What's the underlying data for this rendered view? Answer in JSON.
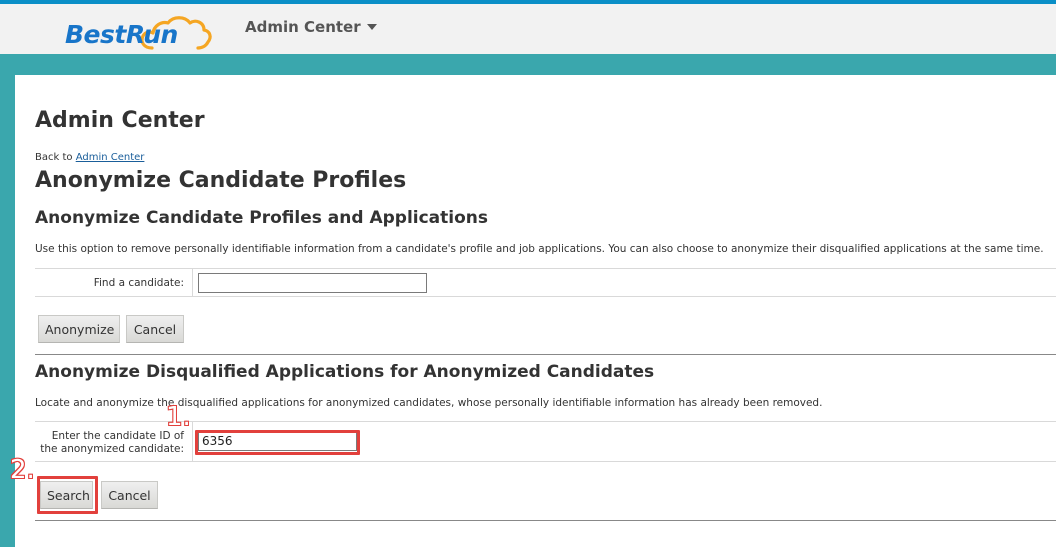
{
  "header": {
    "logo_text": "BestRun",
    "admin_menu_label": "Admin Center"
  },
  "page": {
    "heading": "Admin Center",
    "back_prefix": "Back to",
    "back_link": "Admin Center",
    "title": "Anonymize Candidate Profiles"
  },
  "section1": {
    "title": "Anonymize Candidate Profiles and Applications",
    "description": "Use this option to remove personally identifiable information from a candidate's profile and job applications. You can also choose to anonymize their disqualified applications at the same time.",
    "find_label": "Find a candidate:",
    "find_value": "",
    "anonymize_label": "Anonymize",
    "cancel_label": "Cancel"
  },
  "section2": {
    "title": "Anonymize Disqualified Applications for Anonymized Candidates",
    "description": "Locate and anonymize the disqualified applications for anonymized candidates, whose personally identifiable information has already been removed.",
    "id_label_line1": "Enter the candidate ID of",
    "id_label_line2": "the anonymized candidate:",
    "id_value": "6356",
    "search_label": "Search",
    "cancel_label": "Cancel"
  },
  "annotations": {
    "step1": "1.",
    "step2": "2.",
    "color": "#e2403c"
  },
  "colors": {
    "top_accent": "#0a8fc7",
    "brand_teal": "#3aa7ad",
    "logo_blue": "#1875c9",
    "logo_cloud": "#f5a623"
  }
}
